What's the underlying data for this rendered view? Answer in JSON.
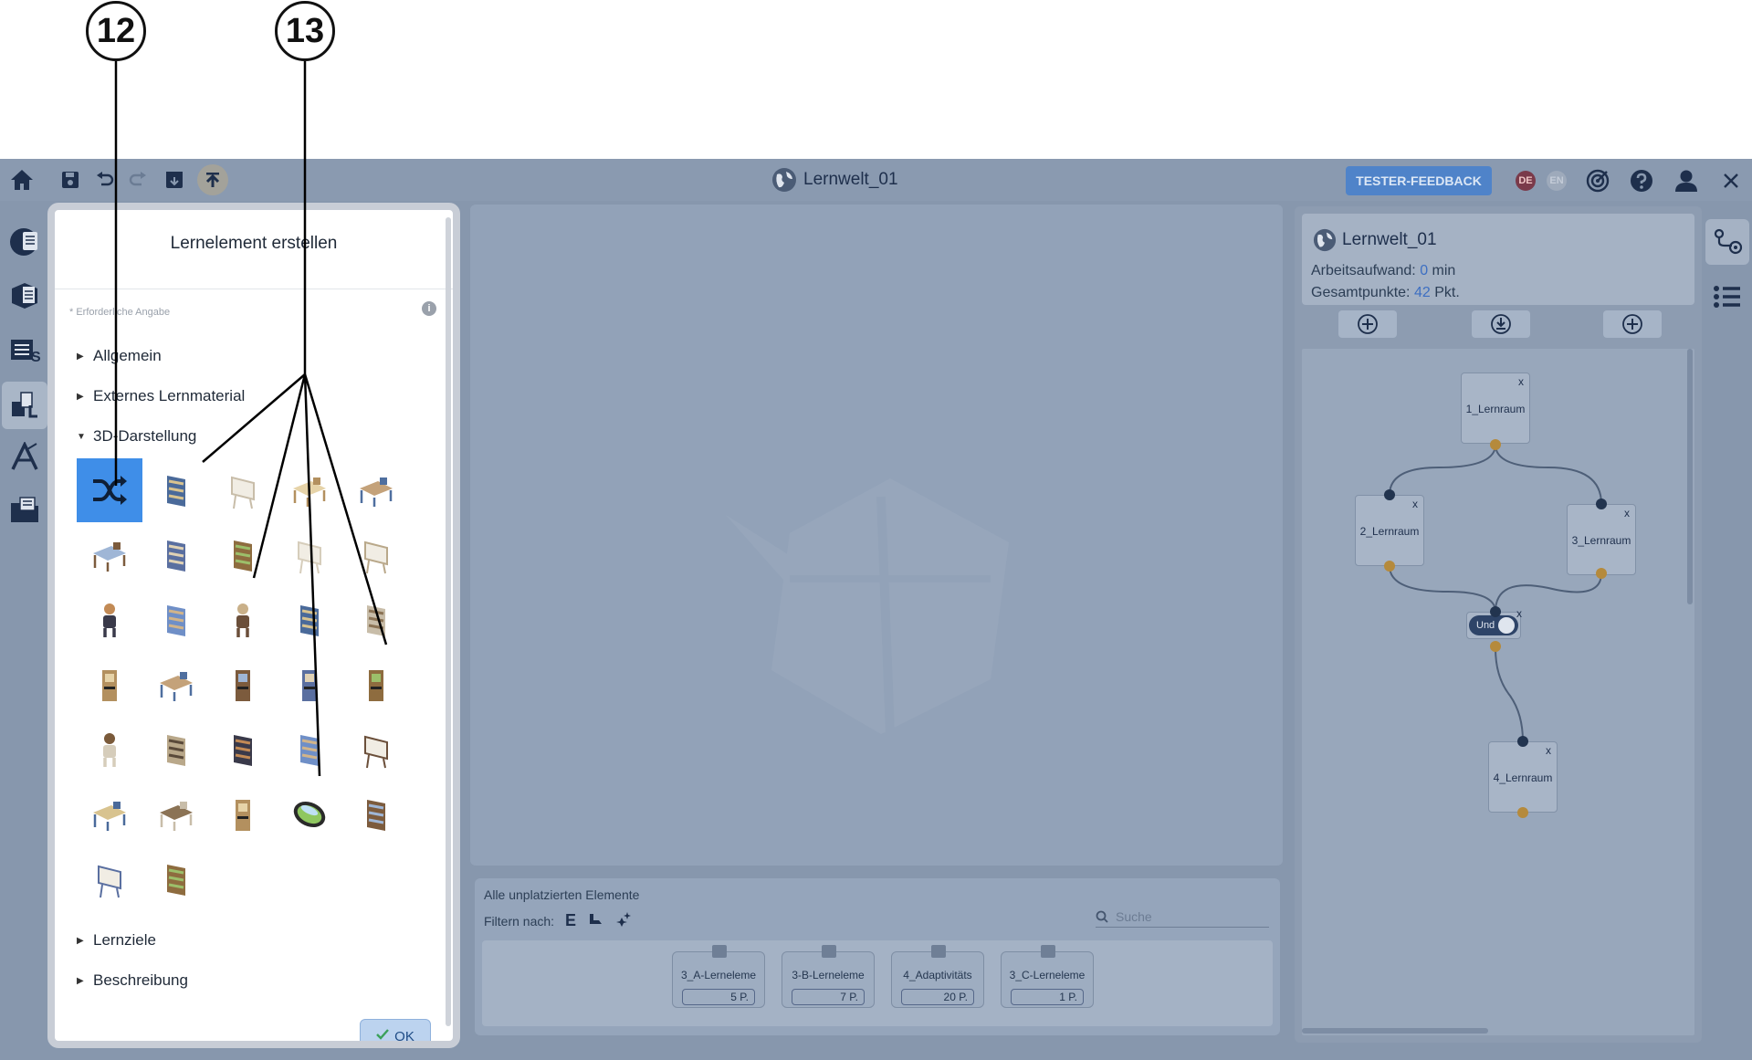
{
  "annotations": {
    "a": "12",
    "b": "13"
  },
  "toolbar": {
    "world_title": "Lernwelt_01",
    "feedback_label": "TESTER-FEEDBACK",
    "lang_de": "DE",
    "lang_en": "EN"
  },
  "dialog": {
    "title": "Lernelement erstellen",
    "required_note": "* Erforderliche Angabe",
    "sections": {
      "general": "Allgemein",
      "external": "Externes Lernmaterial",
      "display3d": "3D-Darstellung",
      "goals": "Lernziele",
      "description": "Beschreibung"
    },
    "ok_label": "OK",
    "model_icons": [
      "random-shuffle-icon",
      "bookshelf-model-icon",
      "whiteboard-model-icon",
      "drafting-table-model-icon",
      "desk-chair-model-icon",
      "school-desk-model-icon",
      "picture-frame-model-icon",
      "painting-model-icon",
      "flipchart-model-icon",
      "standing-board-model-icon",
      "robot-model-icon",
      "book-stack-model-icon",
      "character-model-icon",
      "cabinet-model-icon",
      "shelf-model-icon",
      "arcade-machine-model-icon",
      "gaming-desk-model-icon",
      "arcade-cabinet-model-icon",
      "purple-arcade-model-icon",
      "red-arcade-model-icon",
      "character-two-model-icon",
      "tall-screen-model-icon",
      "plant-stand-model-icon",
      "gaming-chair-model-icon",
      "easel-board-model-icon",
      "office-desk-model-icon",
      "work-table-model-icon",
      "speaker-model-icon",
      "oval-mirror-model-icon",
      "colorful-screen-model-icon",
      "easel-model-icon",
      "tv-console-model-icon"
    ]
  },
  "unplaced": {
    "title": "Alle unplatzierten Elemente",
    "filter_label": "Filtern nach:",
    "search_placeholder": "Suche",
    "cards": [
      {
        "label": "3_A-Lerneleme",
        "points": "5 P."
      },
      {
        "label": "3-B-Lerneleme",
        "points": "7 P."
      },
      {
        "label": "4_Adaptivitäts",
        "points": "20 P."
      },
      {
        "label": "3_C-Lerneleme",
        "points": "1 P."
      }
    ]
  },
  "right_panel": {
    "title": "Lernwelt_01",
    "effort_label": "Arbeitsaufwand:",
    "effort_value": "0",
    "effort_unit": "min",
    "points_label": "Gesamtpunkte:",
    "points_value": "42",
    "points_unit": "Pkt.",
    "nodes": [
      "1_Lernraum",
      "2_Lernraum",
      "3_Lernraum",
      "4_Lernraum"
    ],
    "and_label": "Und",
    "close_mark": "x"
  },
  "colors": {
    "accent": "#3f8ee8",
    "topbar": "#8a9ab0",
    "workspace": "#8797ad",
    "dialog": "#ffffff"
  }
}
